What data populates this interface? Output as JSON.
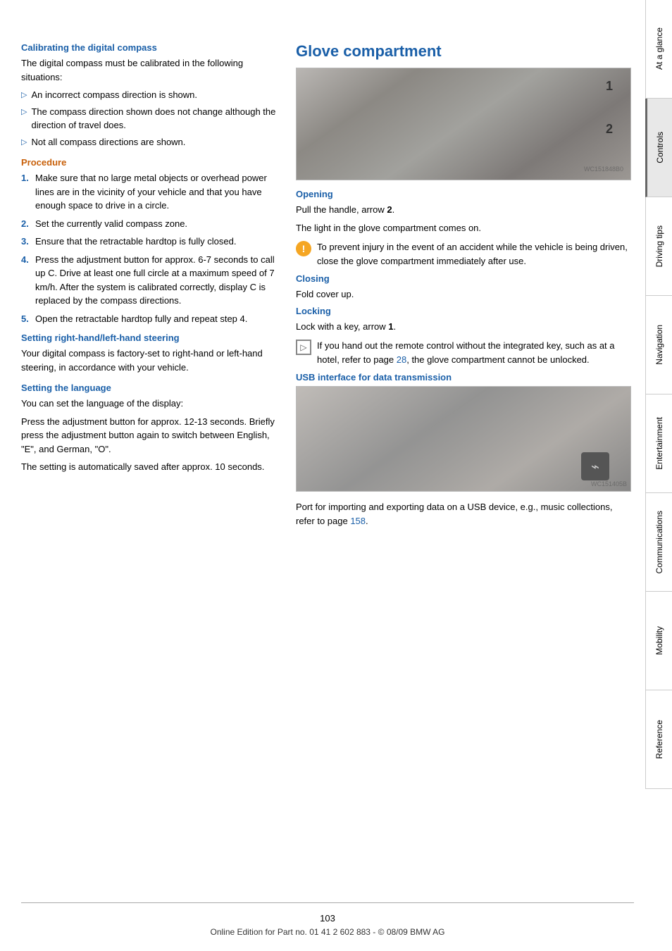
{
  "page": {
    "page_number": "103",
    "footer_text": "Online Edition for Part no. 01 41 2 602 883 - © 08/09 BMW AG"
  },
  "sidebar": {
    "tabs": [
      {
        "id": "at-a-glance",
        "label": "At a glance",
        "active": false
      },
      {
        "id": "controls",
        "label": "Controls",
        "active": true
      },
      {
        "id": "driving-tips",
        "label": "Driving tips",
        "active": false
      },
      {
        "id": "navigation",
        "label": "Navigation",
        "active": false
      },
      {
        "id": "entertainment",
        "label": "Entertainment",
        "active": false
      },
      {
        "id": "communications",
        "label": "Communications",
        "active": false
      },
      {
        "id": "mobility",
        "label": "Mobility",
        "active": false
      },
      {
        "id": "reference",
        "label": "Reference",
        "active": false
      }
    ]
  },
  "left_column": {
    "calibrating_heading": "Calibrating the digital compass",
    "calibrating_intro": "The digital compass must be calibrated in the following situations:",
    "calibrating_bullets": [
      "An incorrect compass direction is shown.",
      "The compass direction shown does not change although the direction of travel does.",
      "Not all compass directions are shown."
    ],
    "procedure_heading": "Procedure",
    "procedure_steps": [
      "Make sure that no large metal objects or overhead power lines are in the vicinity of your vehicle and that you have enough space to drive in a circle.",
      "Set the currently valid compass zone.",
      "Ensure that the retractable hardtop is fully closed.",
      "Press the adjustment button for approx. 6-7 seconds to call up C. Drive at least one full circle at a maximum speed of 7 km/h. After the system is calibrated correctly, display C is replaced by the compass directions.",
      "Open the retractable hardtop fully and repeat step 4."
    ],
    "setting_steering_heading": "Setting right-hand/left-hand steering",
    "setting_steering_text": "Your digital compass is factory-set to right-hand or left-hand steering, in accordance with your vehicle.",
    "setting_language_heading": "Setting the language",
    "setting_language_text1": "You can set the language of the display:",
    "setting_language_text2": "Press the adjustment button for approx. 12-13 seconds. Briefly press the adjustment button again to switch between English, \"E\", and German, \"O\".",
    "setting_language_text3": "The setting is automatically saved after approx. 10 seconds."
  },
  "right_column": {
    "glove_heading": "Glove compartment",
    "opening_heading": "Opening",
    "opening_text1": "Pull the handle, arrow 2.",
    "opening_text2": "The light in the glove compartment comes on.",
    "opening_warning": "To prevent injury in the event of an accident while the vehicle is being driven, close the glove compartment immediately after use.",
    "closing_heading": "Closing",
    "closing_text": "Fold cover up.",
    "locking_heading": "Locking",
    "locking_text": "Lock with a key, arrow 1.",
    "locking_note": "If you hand out the remote control without the integrated key, such as at a hotel, refer to page 28, the glove compartment cannot be unlocked.",
    "locking_note_page": "28",
    "usb_heading": "USB interface for data transmission",
    "usb_text": "Port for importing and exporting data on a USB device, e.g., music collections, refer to page 158.",
    "usb_page_ref": "158"
  }
}
